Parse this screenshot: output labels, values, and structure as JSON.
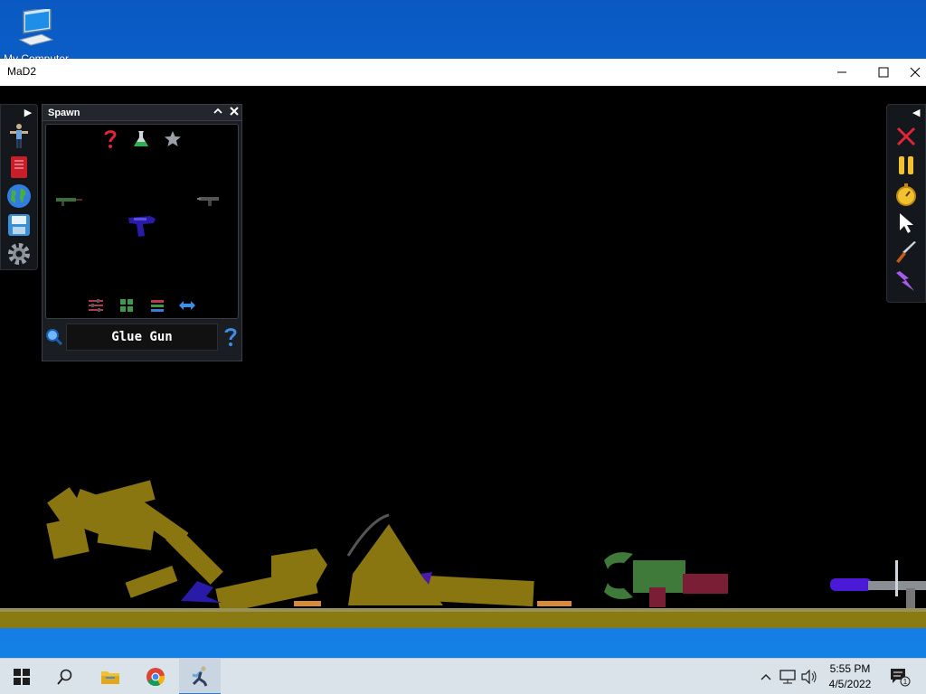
{
  "desktop": {
    "icon_label": "My Computer"
  },
  "window": {
    "title": "MaD2"
  },
  "spawn_panel": {
    "title": "Spawn",
    "selected_item": "Glue Gun"
  },
  "taskbar": {
    "time": "5:55 PM",
    "date": "4/5/2022",
    "notification_count": "1"
  },
  "colors": {
    "floor": "#8a7a12",
    "ragdoll": "#8a7610",
    "glue_gun": "#2a1aa8",
    "panel_bg": "#1a1d21"
  }
}
